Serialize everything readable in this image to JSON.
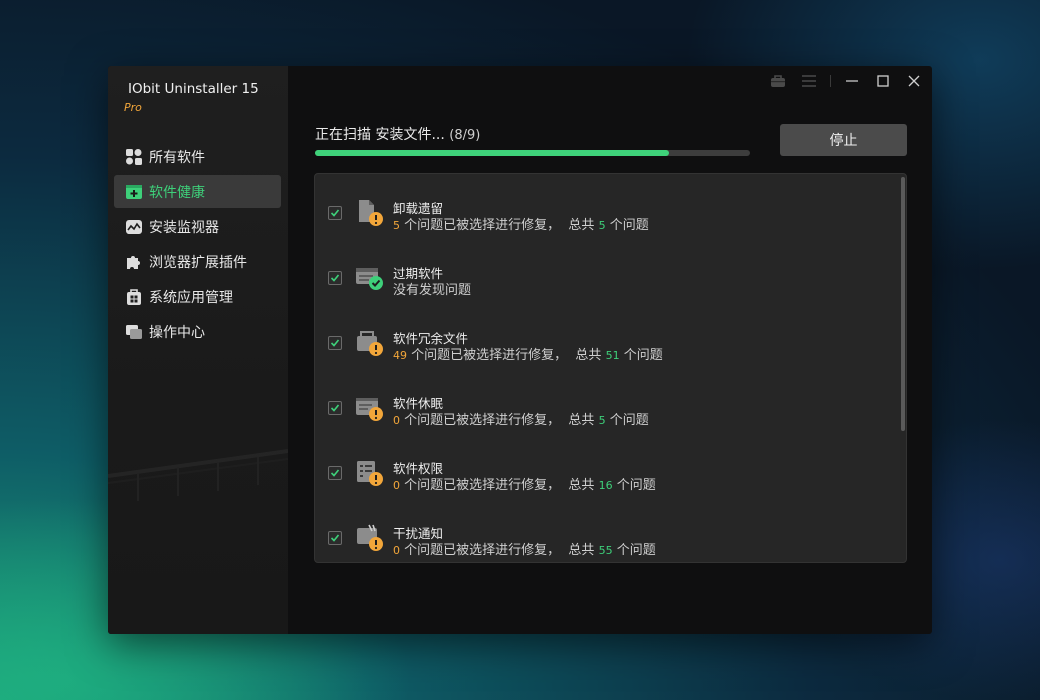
{
  "app": {
    "title": "IObit Uninstaller 15",
    "edition": "Pro"
  },
  "sidebar": {
    "items": [
      {
        "label": "所有软件",
        "icon": "all-apps-icon",
        "active": false
      },
      {
        "label": "软件健康",
        "icon": "health-icon",
        "active": true
      },
      {
        "label": "安装监视器",
        "icon": "monitor-icon",
        "active": false
      },
      {
        "label": "浏览器扩展插件",
        "icon": "puzzle-icon",
        "active": false
      },
      {
        "label": "系统应用管理",
        "icon": "windows-apps-icon",
        "active": false
      },
      {
        "label": "操作中心",
        "icon": "action-center-icon",
        "active": false
      }
    ]
  },
  "scan": {
    "status": "正在扫描 安装文件...",
    "count": "(8/9)",
    "progress": 0.814,
    "stop_label": "停止"
  },
  "colors": {
    "accent": "#3ed07a",
    "warning": "#f2a63a"
  },
  "results": [
    {
      "title": "卸载遗留",
      "icon": "leftover-file-icon",
      "badge": "warning",
      "fixed": "5",
      "fixed_text": "个问题已被选择进行修复，",
      "total_prefix": "总共",
      "total": "5",
      "total_suffix": "个问题"
    },
    {
      "title": "过期软件",
      "icon": "outdated-software-icon",
      "badge": "ok",
      "message": "没有发现问题"
    },
    {
      "title": "软件冗余文件",
      "icon": "redundant-files-icon",
      "badge": "warning",
      "fixed": "49",
      "fixed_text": "个问题已被选择进行修复，",
      "total_prefix": "总共",
      "total": "51",
      "total_suffix": "个问题"
    },
    {
      "title": "软件休眠",
      "icon": "sleeping-software-icon",
      "badge": "warning",
      "fixed": "0",
      "fixed_text": "个问题已被选择进行修复，",
      "total_prefix": "总共",
      "total": "5",
      "total_suffix": "个问题"
    },
    {
      "title": "软件权限",
      "icon": "permissions-icon",
      "badge": "warning",
      "fixed": "0",
      "fixed_text": "个问题已被选择进行修复，",
      "total_prefix": "总共",
      "total": "16",
      "total_suffix": "个问题"
    },
    {
      "title": "干扰通知",
      "icon": "notification-icon",
      "badge": "warning",
      "fixed": "0",
      "fixed_text": "个问题已被选择进行修复，",
      "total_prefix": "总共",
      "total": "55",
      "total_suffix": "个问题"
    }
  ]
}
